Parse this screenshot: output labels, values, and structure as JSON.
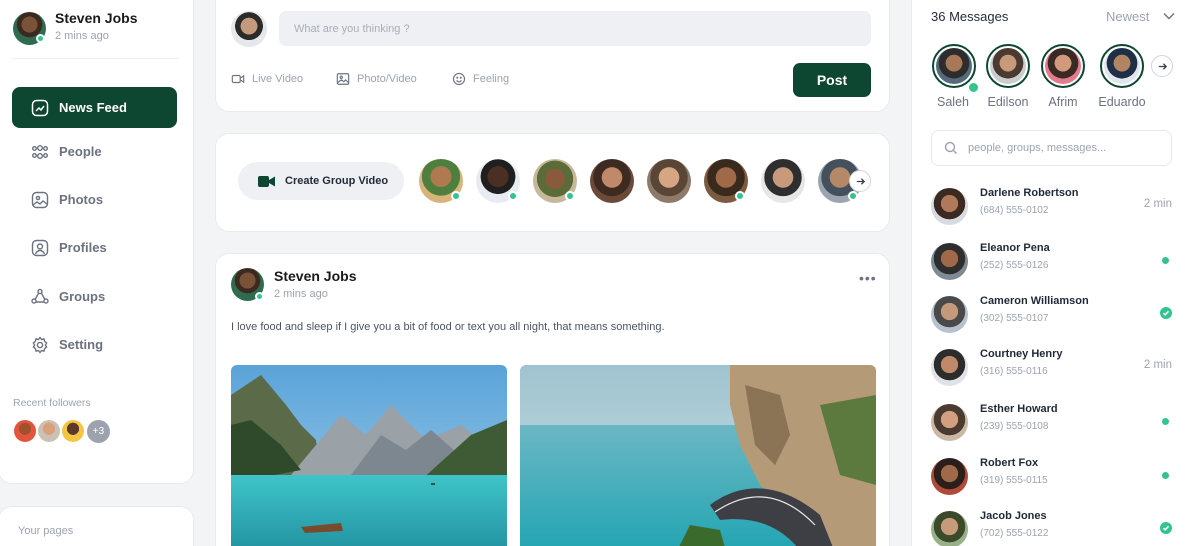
{
  "profile": {
    "name": "Steven Jobs",
    "time": "2 mins ago"
  },
  "nav": [
    {
      "label": "News Feed",
      "icon": "news-feed-icon",
      "active": true
    },
    {
      "label": "People",
      "icon": "people-icon"
    },
    {
      "label": "Photos",
      "icon": "photos-icon"
    },
    {
      "label": "Profiles",
      "icon": "profiles-icon"
    },
    {
      "label": "Groups",
      "icon": "groups-icon"
    },
    {
      "label": "Setting",
      "icon": "setting-icon"
    }
  ],
  "followers": {
    "label": "Recent followers",
    "more": "+3"
  },
  "pages": {
    "label": "Your pages"
  },
  "composer": {
    "placeholder": "What are you thinking ?",
    "live_video": "Live Video",
    "photo_video": "Photo/Video",
    "feeling": "Feeling",
    "post_label": "Post"
  },
  "group_video": {
    "label": "Create Group Video"
  },
  "post": {
    "author": "Steven Jobs",
    "time": "2 mins ago",
    "text": "I love food and sleep if I give you a bit of food or text you all night, that means something."
  },
  "messages": {
    "title": "36 Messages",
    "sort": "Newest",
    "search_placeholder": "people, groups, messages...",
    "stories": [
      "Saleh",
      "Edilson",
      "Afrim",
      "Eduardo"
    ],
    "contacts": [
      {
        "name": "Darlene Robertson",
        "phone": "(684) 555-0102",
        "time": "2 min",
        "status": "time"
      },
      {
        "name": "Eleanor Pena",
        "phone": "(252) 555-0126",
        "time": "",
        "status": "dot"
      },
      {
        "name": "Cameron Williamson",
        "phone": "(302) 555-0107",
        "time": "",
        "status": "check"
      },
      {
        "name": "Courtney Henry",
        "phone": "(316) 555-0116",
        "time": "2 min",
        "status": "time"
      },
      {
        "name": "Esther Howard",
        "phone": "(239) 555-0108",
        "time": "",
        "status": "dot"
      },
      {
        "name": "Robert Fox",
        "phone": "(319) 555-0115",
        "time": "",
        "status": "dot"
      },
      {
        "name": "Jacob Jones",
        "phone": "(702) 555-0122",
        "time": "",
        "status": "check"
      }
    ]
  },
  "colors": {
    "accent": "#0d4631",
    "online": "#34c38f",
    "muted": "#9ca3af"
  }
}
